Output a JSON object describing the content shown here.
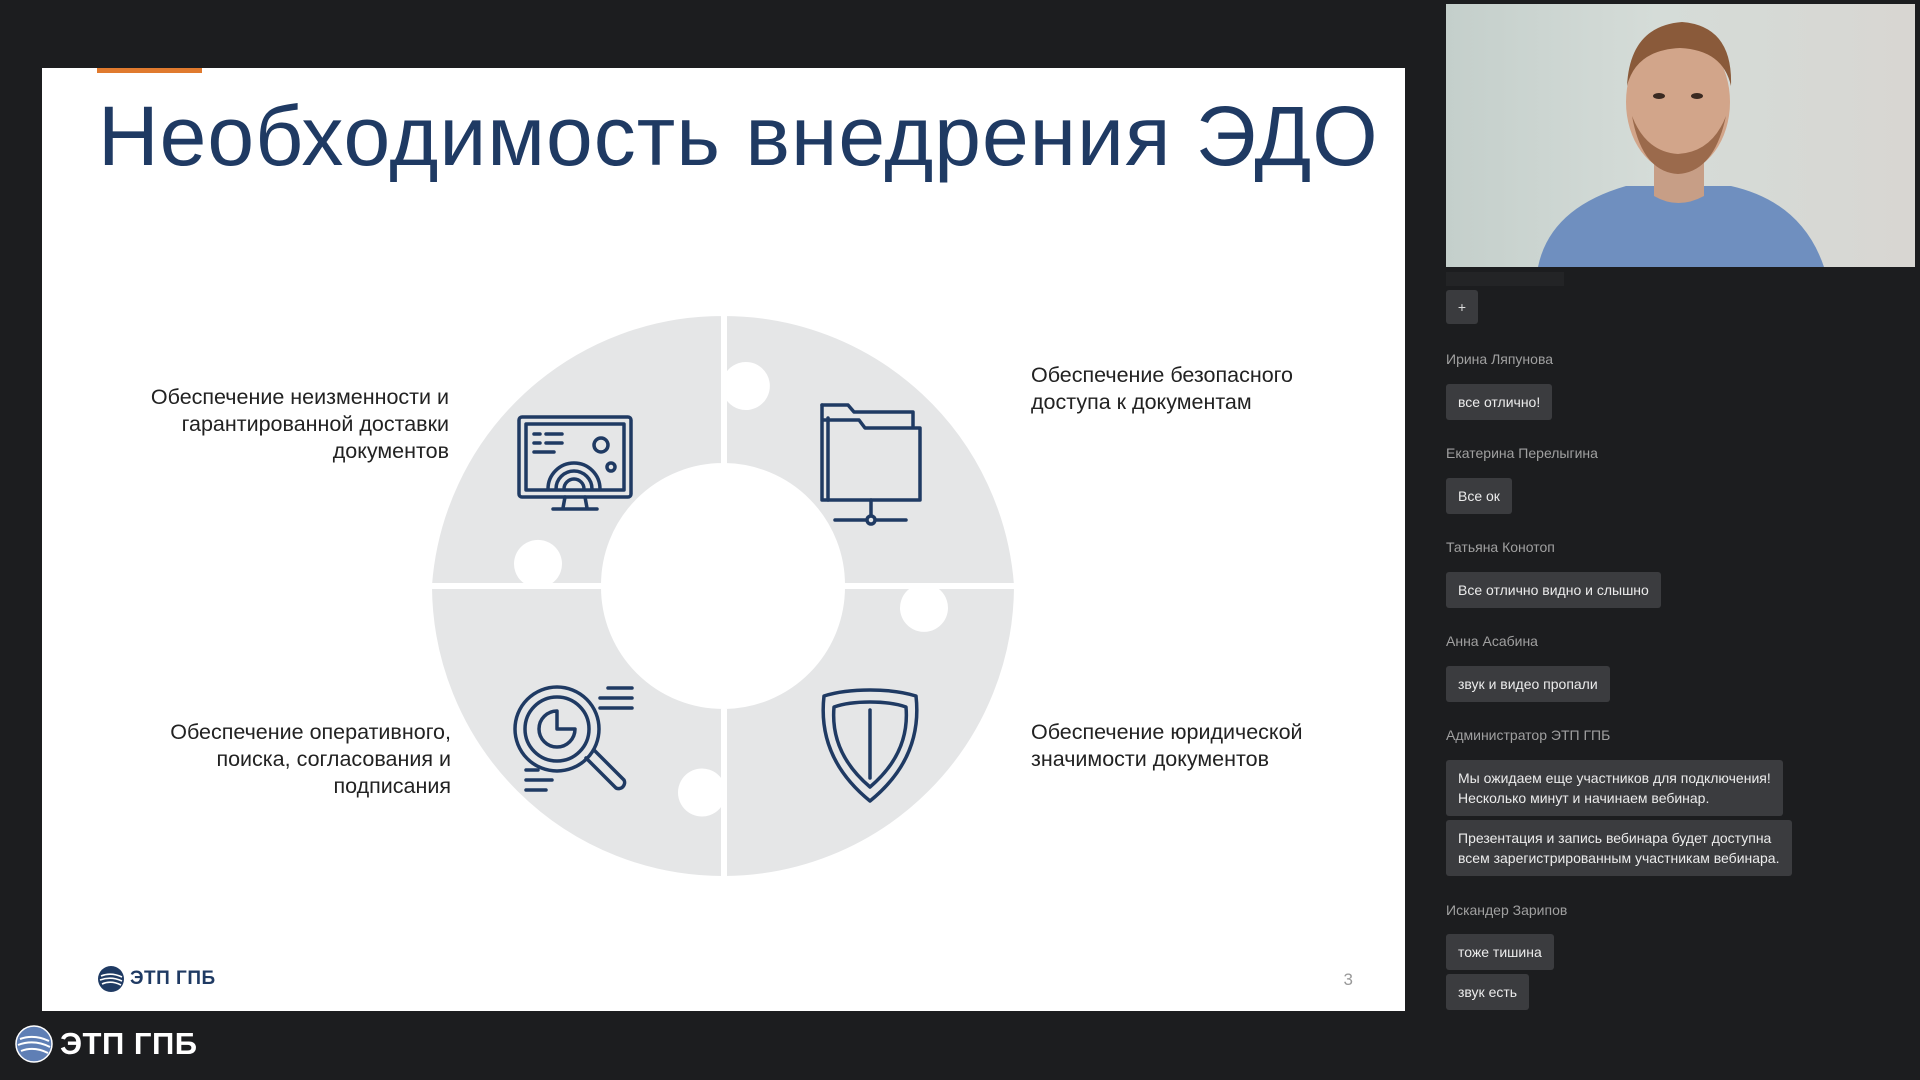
{
  "slide": {
    "title": "Необходимость внедрения ЭДО",
    "captions": {
      "top_left": [
        "Обеспечение неизменности и",
        "гарантированной доставки",
        "документов"
      ],
      "top_right": [
        "Обеспечение безопасного",
        "доступа к документам"
      ],
      "bottom_left": [
        "Обеспечение оперативного,",
        "поиска, согласования и",
        "подписания"
      ],
      "bottom_right": [
        "Обеспечение юридической",
        "значимости документов"
      ]
    },
    "icons": [
      "monitor-settings-icon",
      "folder-network-icon",
      "magnifier-document-icon",
      "shield-icon"
    ],
    "logo_text": "ЭТП ГПБ",
    "page_number": "3",
    "colors": {
      "title": "#1f3a63",
      "accent": "#e07a2e",
      "puzzle": "#e5e6e7",
      "icon": "#1f3a63"
    }
  },
  "chat": {
    "add_label": "+",
    "messages": [
      {
        "sender": "Ирина Ляпунова",
        "texts": [
          "все отлично!"
        ]
      },
      {
        "sender": "Екатерина Перелыгина",
        "texts": [
          "Все ок"
        ]
      },
      {
        "sender": "Татьяна Конотоп",
        "texts": [
          "Все отлично видно и слышно"
        ]
      },
      {
        "sender": "Анна Асабина",
        "texts": [
          "звук и видео пропали"
        ]
      },
      {
        "sender": "Администратор ЭТП ГПБ",
        "texts": [
          [
            "Мы ожидаем еще участников для подключения!",
            "Несколько минут и начинаем вебинар."
          ],
          [
            "Презентация и запись вебинара будет доступна",
            "всем зарегистрированным участникам вебинара."
          ]
        ]
      },
      {
        "sender": "Искандер Зарипов",
        "texts": [
          "тоже тишина",
          "звук есть"
        ]
      }
    ]
  },
  "footer": {
    "logo_text": "ЭТП ГПБ"
  }
}
